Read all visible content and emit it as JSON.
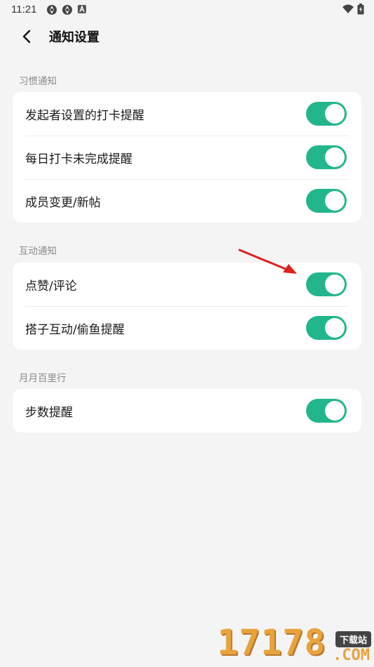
{
  "status_bar": {
    "time": "11:21"
  },
  "header": {
    "title": "通知设置"
  },
  "sections": [
    {
      "header": "习惯通知",
      "items": [
        {
          "label": "发起者设置的打卡提醒",
          "enabled": true
        },
        {
          "label": "每日打卡未完成提醒",
          "enabled": true
        },
        {
          "label": "成员变更/新帖",
          "enabled": true
        }
      ]
    },
    {
      "header": "互动通知",
      "items": [
        {
          "label": "点赞/评论",
          "enabled": true
        },
        {
          "label": "搭子互动/偷鱼提醒",
          "enabled": true
        }
      ]
    },
    {
      "header": "月月百里行",
      "items": [
        {
          "label": "步数提醒",
          "enabled": true
        }
      ]
    }
  ],
  "watermark": {
    "text": "17178",
    "badge": "下载站",
    "suffix": ".COM"
  },
  "colors": {
    "toggle_on": "#23b68c",
    "background": "#f4f4f4",
    "annotation_arrow": "#e02020"
  }
}
